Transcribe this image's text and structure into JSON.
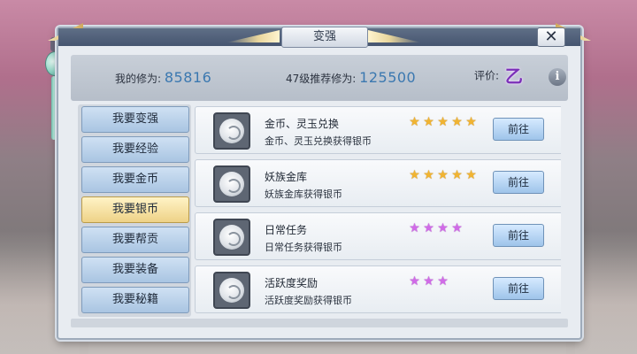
{
  "window": {
    "title": "变强",
    "close_icon": "close-icon",
    "close_glyph": "✕"
  },
  "header": {
    "cultivation_label": "我的修为:",
    "cultivation_value": "85816",
    "recommend_label": "47级推荐修为:",
    "recommend_value": "125500",
    "rating_label": "评价:",
    "rating_grade": "乙",
    "info_glyph": "i"
  },
  "sidebar": {
    "items": [
      {
        "label": "我要变强",
        "active": false
      },
      {
        "label": "我要经验",
        "active": false
      },
      {
        "label": "我要金币",
        "active": false
      },
      {
        "label": "我要银币",
        "active": true
      },
      {
        "label": "我要帮贡",
        "active": false
      },
      {
        "label": "我要装备",
        "active": false
      },
      {
        "label": "我要秘籍",
        "active": false
      }
    ]
  },
  "list": {
    "rows": [
      {
        "title": "金币、灵玉兑换",
        "desc": "金币、灵玉兑换获得银币",
        "stars": 5,
        "star_color": "gold",
        "button": "前往"
      },
      {
        "title": "妖族金库",
        "desc": "妖族金库获得银币",
        "stars": 5,
        "star_color": "gold",
        "button": "前往"
      },
      {
        "title": "日常任务",
        "desc": "日常任务获得银币",
        "stars": 4,
        "star_color": "purple",
        "button": "前往"
      },
      {
        "title": "活跃度奖励",
        "desc": "活跃度奖励获得银币",
        "stars": 3,
        "star_color": "purple",
        "button": "前往"
      }
    ]
  },
  "colors": {
    "gold_star": "#f1b431",
    "purple_star": "#d16be8",
    "value_blue": "#3b78b0",
    "grade_purple": "#7b2fb8"
  }
}
